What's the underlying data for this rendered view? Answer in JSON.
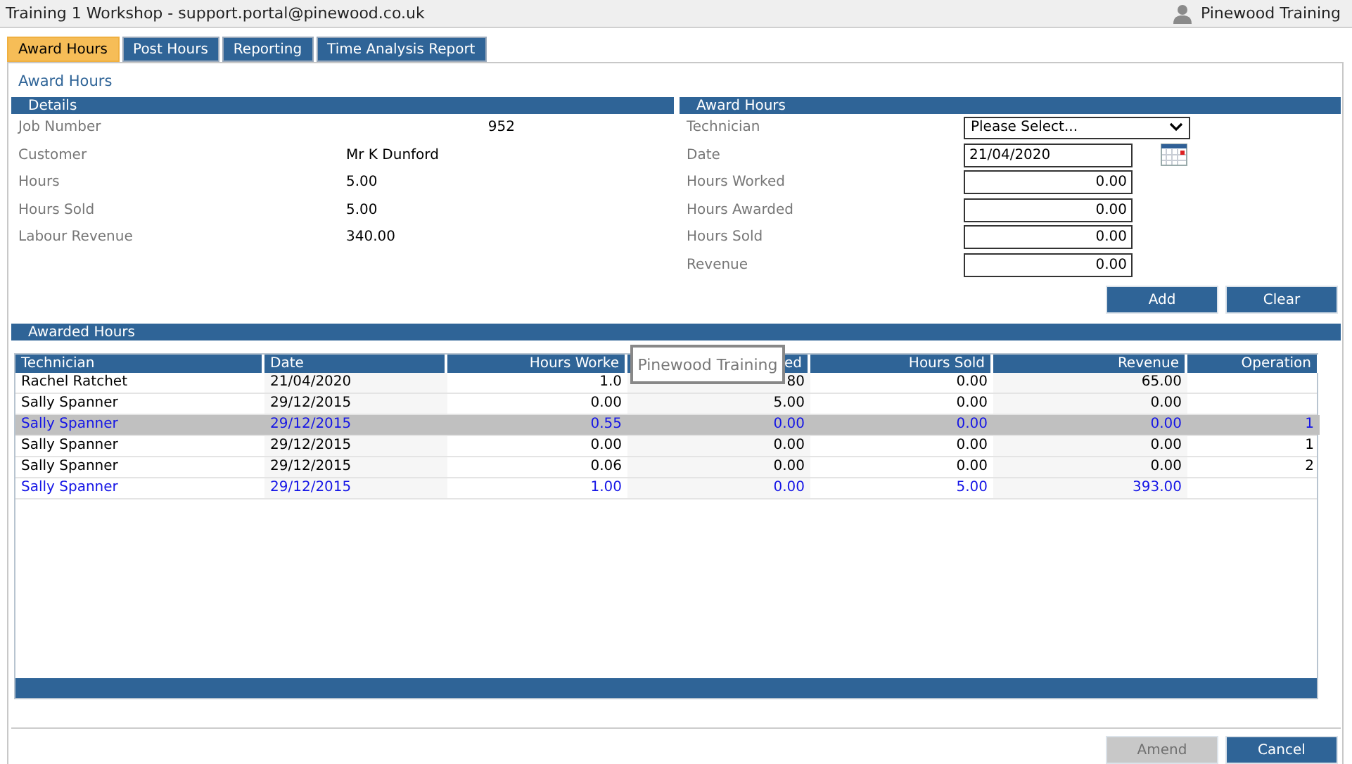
{
  "window": {
    "title": "Training 1 Workshop - support.portal@pinewood.co.uk",
    "user": "Pinewood Training"
  },
  "tabs": [
    {
      "label": "Award Hours",
      "selected": true
    },
    {
      "label": "Post Hours",
      "selected": false
    },
    {
      "label": "Reporting",
      "selected": false
    },
    {
      "label": "Time Analysis Report",
      "selected": false
    }
  ],
  "page_title": "Award Hours",
  "details": {
    "heading": "Details",
    "fields": [
      {
        "label": "Job Number",
        "value": "952"
      },
      {
        "label": "Customer",
        "value": "Mr K Dunford"
      },
      {
        "label": "Hours",
        "value": "5.00"
      },
      {
        "label": "Hours Sold",
        "value": "5.00"
      },
      {
        "label": "Labour Revenue",
        "value": "340.00"
      }
    ]
  },
  "award_form": {
    "heading": "Award Hours",
    "fields": [
      {
        "kind": "select",
        "label": "Technician",
        "value": "Please Select..."
      },
      {
        "kind": "date",
        "label": "Date",
        "value": "21/04/2020"
      },
      {
        "kind": "number",
        "label": "Hours Worked",
        "value": "0.00"
      },
      {
        "kind": "number",
        "label": "Hours Awarded",
        "value": "0.00"
      },
      {
        "kind": "number",
        "label": "Hours Sold",
        "value": "0.00"
      },
      {
        "kind": "number",
        "label": "Revenue",
        "value": "0.00"
      }
    ],
    "buttons": [
      {
        "label": "Add",
        "disabled": false
      },
      {
        "label": "Clear",
        "disabled": false
      }
    ]
  },
  "awarded_hours": {
    "heading": "Awarded Hours",
    "columns": [
      "Technician",
      "Date",
      "Hours Worke",
      "ed",
      "Hours Sold",
      "Revenue",
      "Operation"
    ],
    "rows": [
      {
        "selected": false,
        "flagged": false,
        "cells": [
          "Rachel Ratchet",
          "21/04/2020",
          "1.0",
          "80",
          "0.00",
          "65.00",
          null
        ]
      },
      {
        "selected": false,
        "flagged": false,
        "cells": [
          "Sally Spanner",
          "29/12/2015",
          "0.00",
          "5.00",
          "0.00",
          "0.00",
          null
        ]
      },
      {
        "selected": true,
        "flagged": true,
        "cells": [
          "Sally Spanner",
          "29/12/2015",
          "0.55",
          "0.00",
          "0.00",
          "0.00",
          "1"
        ]
      },
      {
        "selected": false,
        "flagged": false,
        "cells": [
          "Sally Spanner",
          "29/12/2015",
          "0.00",
          "0.00",
          "0.00",
          "0.00",
          "1"
        ]
      },
      {
        "selected": false,
        "flagged": false,
        "cells": [
          "Sally Spanner",
          "29/12/2015",
          "0.06",
          "0.00",
          "0.00",
          "0.00",
          "2"
        ]
      },
      {
        "selected": false,
        "flagged": true,
        "cells": [
          "Sally Spanner",
          "29/12/2015",
          "1.00",
          "0.00",
          "5.00",
          "393.00",
          null
        ]
      }
    ]
  },
  "tooltip": "Pinewood Training",
  "footer_buttons": [
    {
      "label": "Amend",
      "disabled": true
    },
    {
      "label": "Cancel",
      "disabled": false
    }
  ]
}
